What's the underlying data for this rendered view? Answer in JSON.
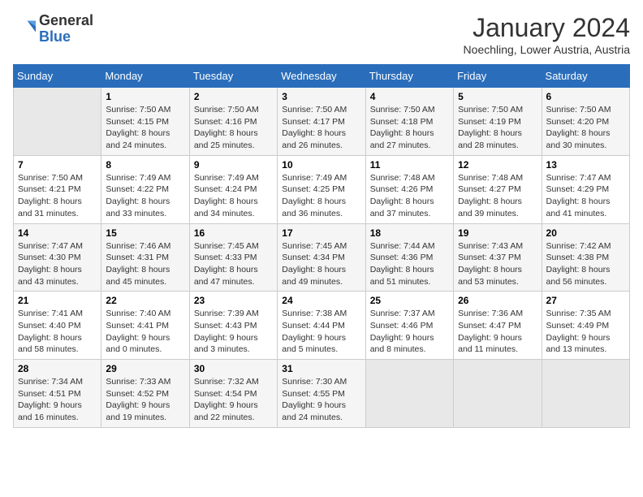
{
  "header": {
    "logo_general": "General",
    "logo_blue": "Blue",
    "month_year": "January 2024",
    "location": "Noechling, Lower Austria, Austria"
  },
  "weekdays": [
    "Sunday",
    "Monday",
    "Tuesday",
    "Wednesday",
    "Thursday",
    "Friday",
    "Saturday"
  ],
  "weeks": [
    [
      {
        "day": "",
        "content": ""
      },
      {
        "day": "1",
        "content": "Sunrise: 7:50 AM\nSunset: 4:15 PM\nDaylight: 8 hours\nand 24 minutes."
      },
      {
        "day": "2",
        "content": "Sunrise: 7:50 AM\nSunset: 4:16 PM\nDaylight: 8 hours\nand 25 minutes."
      },
      {
        "day": "3",
        "content": "Sunrise: 7:50 AM\nSunset: 4:17 PM\nDaylight: 8 hours\nand 26 minutes."
      },
      {
        "day": "4",
        "content": "Sunrise: 7:50 AM\nSunset: 4:18 PM\nDaylight: 8 hours\nand 27 minutes."
      },
      {
        "day": "5",
        "content": "Sunrise: 7:50 AM\nSunset: 4:19 PM\nDaylight: 8 hours\nand 28 minutes."
      },
      {
        "day": "6",
        "content": "Sunrise: 7:50 AM\nSunset: 4:20 PM\nDaylight: 8 hours\nand 30 minutes."
      }
    ],
    [
      {
        "day": "7",
        "content": "Sunrise: 7:50 AM\nSunset: 4:21 PM\nDaylight: 8 hours\nand 31 minutes."
      },
      {
        "day": "8",
        "content": "Sunrise: 7:49 AM\nSunset: 4:22 PM\nDaylight: 8 hours\nand 33 minutes."
      },
      {
        "day": "9",
        "content": "Sunrise: 7:49 AM\nSunset: 4:24 PM\nDaylight: 8 hours\nand 34 minutes."
      },
      {
        "day": "10",
        "content": "Sunrise: 7:49 AM\nSunset: 4:25 PM\nDaylight: 8 hours\nand 36 minutes."
      },
      {
        "day": "11",
        "content": "Sunrise: 7:48 AM\nSunset: 4:26 PM\nDaylight: 8 hours\nand 37 minutes."
      },
      {
        "day": "12",
        "content": "Sunrise: 7:48 AM\nSunset: 4:27 PM\nDaylight: 8 hours\nand 39 minutes."
      },
      {
        "day": "13",
        "content": "Sunrise: 7:47 AM\nSunset: 4:29 PM\nDaylight: 8 hours\nand 41 minutes."
      }
    ],
    [
      {
        "day": "14",
        "content": "Sunrise: 7:47 AM\nSunset: 4:30 PM\nDaylight: 8 hours\nand 43 minutes."
      },
      {
        "day": "15",
        "content": "Sunrise: 7:46 AM\nSunset: 4:31 PM\nDaylight: 8 hours\nand 45 minutes."
      },
      {
        "day": "16",
        "content": "Sunrise: 7:45 AM\nSunset: 4:33 PM\nDaylight: 8 hours\nand 47 minutes."
      },
      {
        "day": "17",
        "content": "Sunrise: 7:45 AM\nSunset: 4:34 PM\nDaylight: 8 hours\nand 49 minutes."
      },
      {
        "day": "18",
        "content": "Sunrise: 7:44 AM\nSunset: 4:36 PM\nDaylight: 8 hours\nand 51 minutes."
      },
      {
        "day": "19",
        "content": "Sunrise: 7:43 AM\nSunset: 4:37 PM\nDaylight: 8 hours\nand 53 minutes."
      },
      {
        "day": "20",
        "content": "Sunrise: 7:42 AM\nSunset: 4:38 PM\nDaylight: 8 hours\nand 56 minutes."
      }
    ],
    [
      {
        "day": "21",
        "content": "Sunrise: 7:41 AM\nSunset: 4:40 PM\nDaylight: 8 hours\nand 58 minutes."
      },
      {
        "day": "22",
        "content": "Sunrise: 7:40 AM\nSunset: 4:41 PM\nDaylight: 9 hours\nand 0 minutes."
      },
      {
        "day": "23",
        "content": "Sunrise: 7:39 AM\nSunset: 4:43 PM\nDaylight: 9 hours\nand 3 minutes."
      },
      {
        "day": "24",
        "content": "Sunrise: 7:38 AM\nSunset: 4:44 PM\nDaylight: 9 hours\nand 5 minutes."
      },
      {
        "day": "25",
        "content": "Sunrise: 7:37 AM\nSunset: 4:46 PM\nDaylight: 9 hours\nand 8 minutes."
      },
      {
        "day": "26",
        "content": "Sunrise: 7:36 AM\nSunset: 4:47 PM\nDaylight: 9 hours\nand 11 minutes."
      },
      {
        "day": "27",
        "content": "Sunrise: 7:35 AM\nSunset: 4:49 PM\nDaylight: 9 hours\nand 13 minutes."
      }
    ],
    [
      {
        "day": "28",
        "content": "Sunrise: 7:34 AM\nSunset: 4:51 PM\nDaylight: 9 hours\nand 16 minutes."
      },
      {
        "day": "29",
        "content": "Sunrise: 7:33 AM\nSunset: 4:52 PM\nDaylight: 9 hours\nand 19 minutes."
      },
      {
        "day": "30",
        "content": "Sunrise: 7:32 AM\nSunset: 4:54 PM\nDaylight: 9 hours\nand 22 minutes."
      },
      {
        "day": "31",
        "content": "Sunrise: 7:30 AM\nSunset: 4:55 PM\nDaylight: 9 hours\nand 24 minutes."
      },
      {
        "day": "",
        "content": ""
      },
      {
        "day": "",
        "content": ""
      },
      {
        "day": "",
        "content": ""
      }
    ]
  ]
}
